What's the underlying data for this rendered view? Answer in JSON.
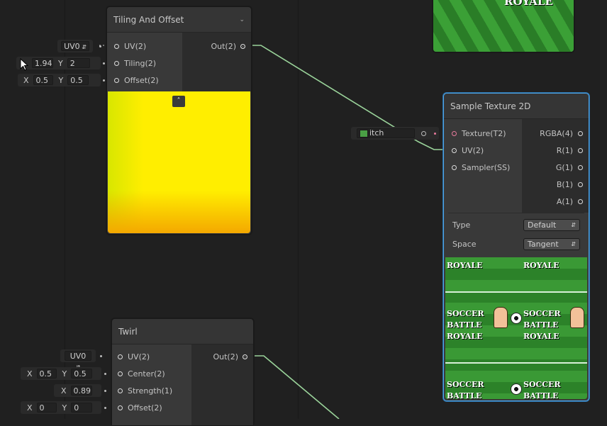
{
  "tiling_node": {
    "title": "Tiling And Offset",
    "inputs": [
      "UV(2)",
      "Tiling(2)",
      "Offset(2)"
    ],
    "output": "Out(2)",
    "uv_channel": "UV0",
    "tiling": {
      "x_label": "",
      "x": "1.94",
      "y_label": "Y",
      "y": "2"
    },
    "offset": {
      "x_label": "X",
      "x": "0.5",
      "y_label": "Y",
      "y": "0.5"
    }
  },
  "sample_node": {
    "title": "Sample Texture 2D",
    "inputs": [
      "Texture(T2)",
      "UV(2)",
      "Sampler(SS)"
    ],
    "outputs": [
      "RGBA(4)",
      "R(1)",
      "G(1)",
      "B(1)",
      "A(1)"
    ],
    "type_label": "Type",
    "type_value": "Default",
    "space_label": "Space",
    "space_value": "Tangent",
    "texture_field": "itch"
  },
  "twirl_node": {
    "title": "Twirl",
    "inputs": [
      "UV(2)",
      "Center(2)",
      "Strength(1)",
      "Offset(2)"
    ],
    "output": "Out(2)",
    "uv_channel": "UV0",
    "center": {
      "x_label": "X",
      "x": "0.5",
      "y_label": "Y",
      "y": "0.5"
    },
    "strength": {
      "x_label": "X",
      "x": "0.89"
    },
    "offset": {
      "x_label": "X",
      "x": "0",
      "y_label": "Y",
      "y": "0"
    }
  },
  "texture_preview": {
    "words": [
      "SOCCER",
      "BATTLE",
      "ROYALE"
    ],
    "partial_word": "ROYALE"
  },
  "colors": {
    "selection": "#4ea4e6",
    "wire": "#9ad39a",
    "preview_yellow": "#ffee00",
    "grass": "#2f8a2c"
  }
}
